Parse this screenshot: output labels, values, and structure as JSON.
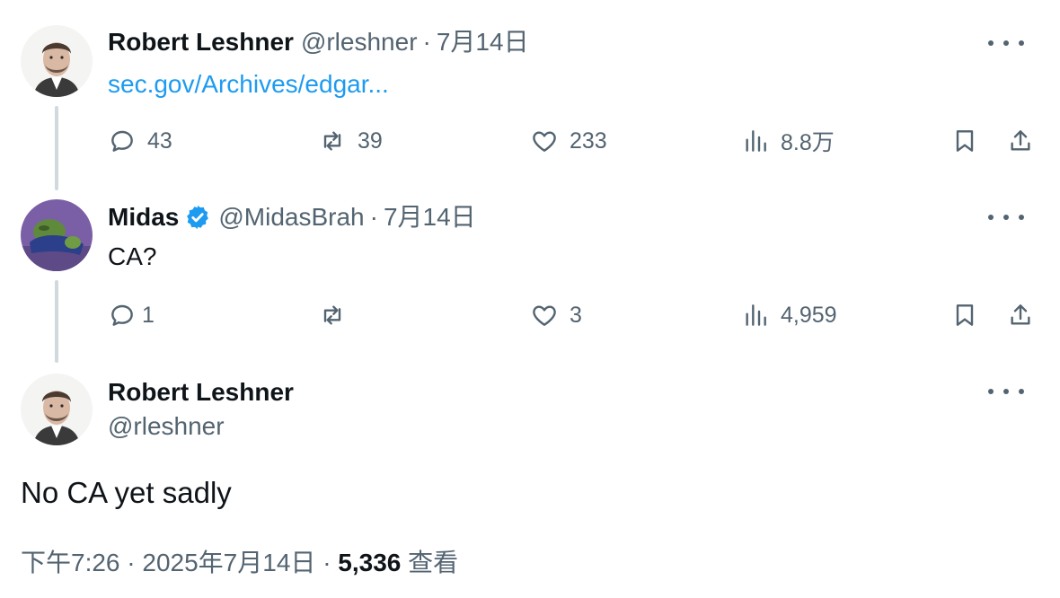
{
  "tweets": [
    {
      "author": "Robert Leshner",
      "handle": "@rleshner",
      "separator": "·",
      "date": "7月14日",
      "link_text": "sec.gov/Archives/edgar...",
      "replies": "43",
      "reposts": "39",
      "likes": "233",
      "views": "8.8万"
    },
    {
      "author": "Midas",
      "verified": true,
      "handle": "@MidasBrah",
      "separator": "·",
      "date": "7月14日",
      "text": "CA?",
      "replies": "1",
      "reposts": "",
      "likes": "3",
      "views": "4,959"
    }
  ],
  "main_tweet": {
    "author": "Robert Leshner",
    "handle": "@rleshner",
    "text": "No CA yet sadly",
    "time": "下午7:26",
    "separator": "·",
    "date": "2025年7月14日",
    "views_count": "5,336",
    "views_label": "查看"
  },
  "colors": {
    "text": "#0f1419",
    "secondary": "#536471",
    "link": "#1d9bf0",
    "verified": "#1d9bf0",
    "thread_line": "#cfd9de"
  },
  "icons": [
    "more-icon",
    "reply-icon",
    "repost-icon",
    "like-icon",
    "views-icon",
    "bookmark-icon",
    "share-icon",
    "verified-badge-icon"
  ]
}
